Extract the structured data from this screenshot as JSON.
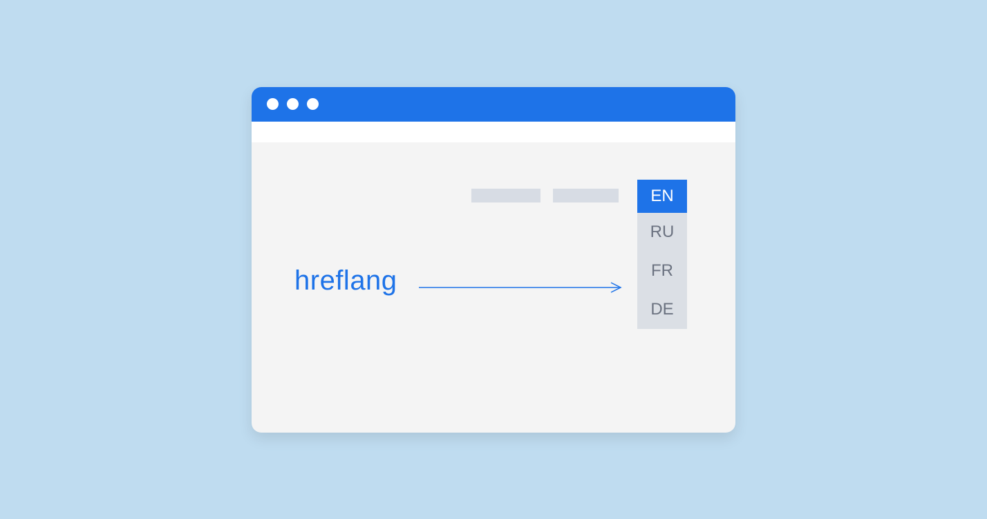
{
  "label": "hreflang",
  "languages": [
    {
      "code": "EN",
      "selected": true
    },
    {
      "code": "RU",
      "selected": false
    },
    {
      "code": "FR",
      "selected": false
    },
    {
      "code": "DE",
      "selected": false
    }
  ],
  "colors": {
    "background": "#BFDCF0",
    "accent": "#1E73E8",
    "panel": "#F4F4F4",
    "placeholder": "#D7DCE4",
    "dropdown": "#DBDFE5",
    "muted_text": "#6B7280"
  }
}
